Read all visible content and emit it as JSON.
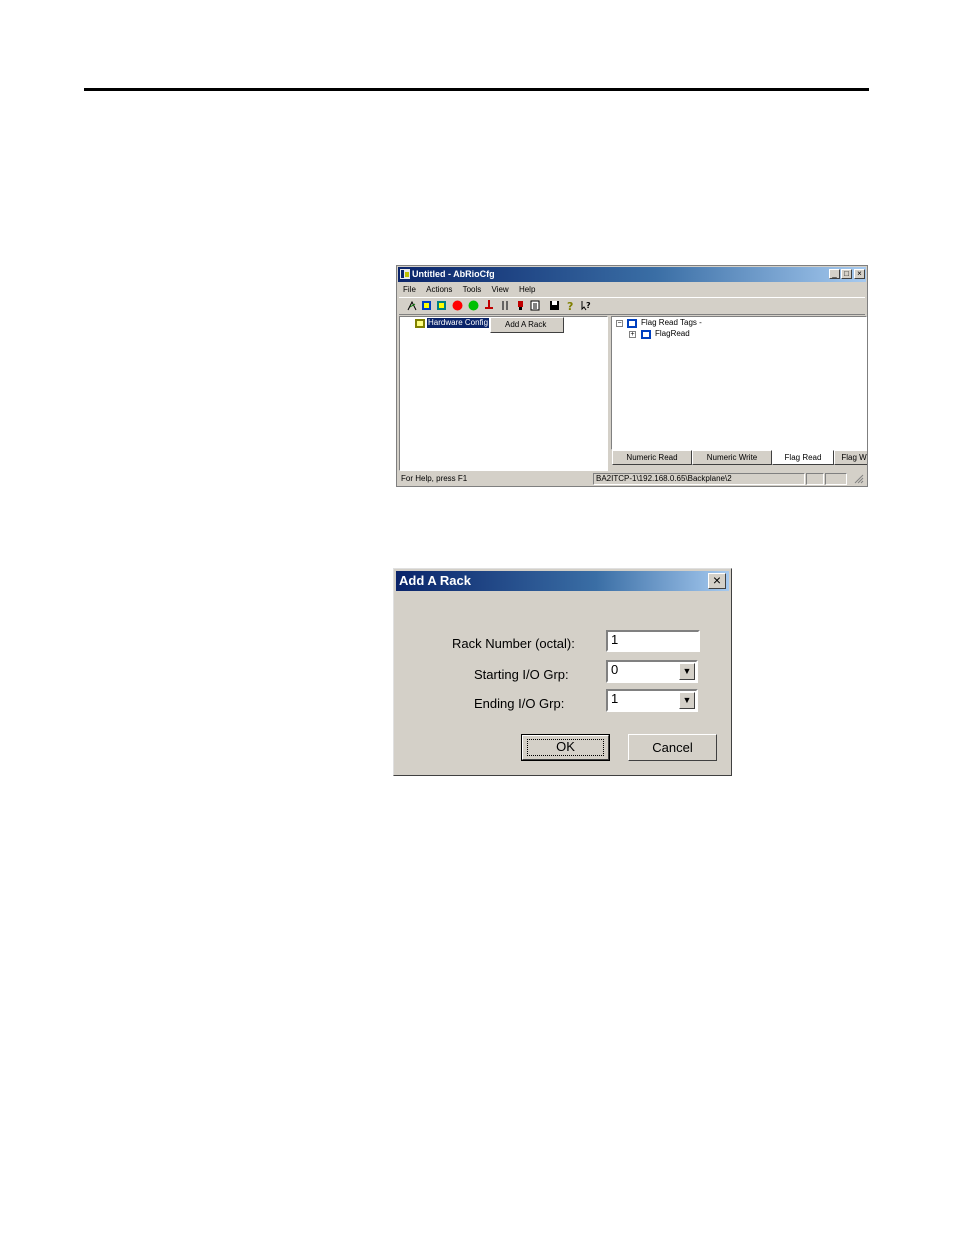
{
  "app": {
    "title": "Untitled - AbRioCfg",
    "menu": [
      "File",
      "Actions",
      "Tools",
      "View",
      "Help"
    ],
    "window_buttons": {
      "minimize": "_",
      "maximize": "□",
      "close": "×"
    },
    "toolbar_icons": [
      "connect-icon",
      "config-icon",
      "config2-icon",
      "stop-red-icon",
      "go-green-icon",
      "download-icon",
      "upload-icon",
      "marker-icon",
      "document-icon",
      "save-icon",
      "help-icon",
      "context-help-icon"
    ],
    "tree": {
      "root_label": "Hardware Config"
    },
    "context_menu": {
      "item": "Add A Rack"
    },
    "right_tree": {
      "root_label": "Flag Read Tags -",
      "child_label": "FlagRead",
      "collapse": "−",
      "expand": "+"
    },
    "tabs": [
      "Numeric Read",
      "Numeric Write",
      "Flag Read",
      "Flag W"
    ],
    "active_tab": "Flag Read",
    "status": {
      "help": "For Help, press F1",
      "path": "BA2ITCP-1\\192.168.0.65\\Backplane\\2"
    }
  },
  "dialog": {
    "title": "Add A Rack",
    "close": "×",
    "rack_number_label": "Rack Number  (octal):",
    "rack_number_value": "1",
    "starting_label": "Starting I/O Grp:",
    "starting_value": "0",
    "ending_label": "Ending I/O Grp:",
    "ending_value": "1",
    "dropdown_glyph": "▼",
    "ok": "OK",
    "cancel": "Cancel"
  },
  "colors": {
    "titlebar_start": "#0a246a",
    "titlebar_end": "#a6caf0",
    "face": "#d4d0c8"
  }
}
